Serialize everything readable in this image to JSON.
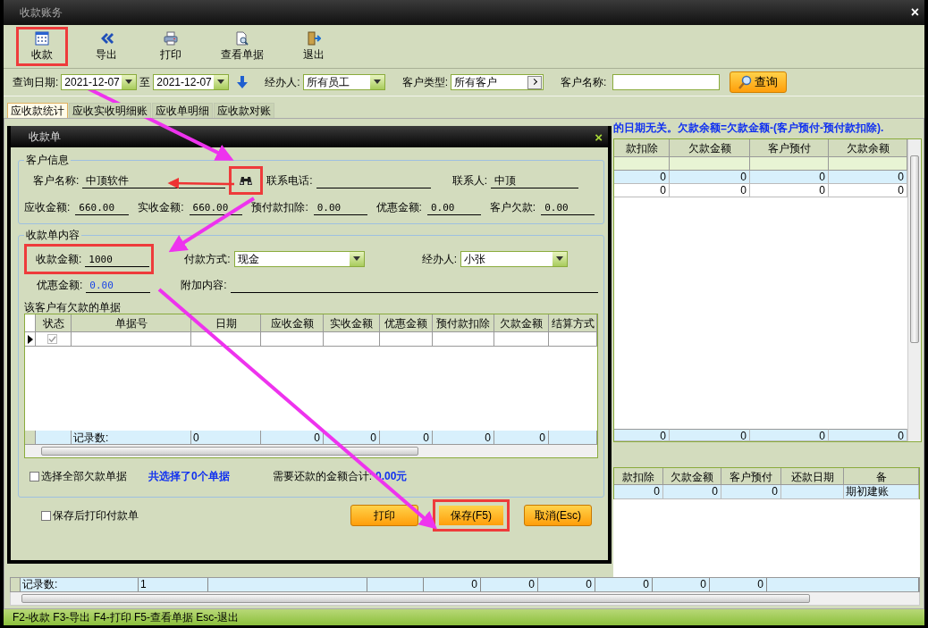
{
  "window": {
    "title": "收款账务",
    "close": "×"
  },
  "toolbar": [
    {
      "label": "收款",
      "kind": "calendar",
      "highlighted": true
    },
    {
      "label": "导出",
      "kind": "chevrons",
      "highlighted": false
    },
    {
      "label": "打印",
      "kind": "printer",
      "highlighted": false
    },
    {
      "label": "查看单据",
      "kind": "document",
      "highlighted": false
    },
    {
      "label": "退出",
      "kind": "exit",
      "highlighted": false
    }
  ],
  "filters": {
    "date_label": "查询日期:",
    "date_from": "2021-12-07",
    "to_label": "至",
    "date_to": "2021-12-07",
    "handler_label": "经办人:",
    "handler": "所有员工",
    "type_label": "客户类型:",
    "type": "所有客户",
    "name_label": "客户名称:",
    "query_button": "查询"
  },
  "tabs": [
    {
      "label": "应收款统计",
      "selected": true
    },
    {
      "label": "应收实收明细账",
      "selected": false
    },
    {
      "label": "应收单明细",
      "selected": false
    },
    {
      "label": "应收款对账",
      "selected": false
    }
  ],
  "notice": "的日期无关。欠款余额=欠款金额-(客户预付-预付款扣除).",
  "upper_grid": {
    "columns": [
      "款扣除",
      "欠款金额",
      "客户预付",
      "欠款余额"
    ],
    "rows": [
      {
        "cells": [
          "0",
          "0",
          "0",
          "0"
        ],
        "selected": true
      },
      {
        "cells": [
          "0",
          "0",
          "0",
          "0"
        ],
        "selected": false
      }
    ],
    "totals": [
      "0",
      "0",
      "0",
      "0"
    ]
  },
  "lower_grid": {
    "columns": [
      "款扣除",
      "欠款金额",
      "客户预付",
      "还款日期",
      "备"
    ],
    "rows": [
      {
        "deduction": "0",
        "arrears": "0",
        "prepaid": "0",
        "note": "期初建账",
        "selected": true
      }
    ]
  },
  "footer": {
    "label": "记录数:",
    "count": "1",
    "values": [
      "0",
      "0",
      "0",
      "0",
      "0",
      "0"
    ]
  },
  "status_bar": "F2-收款 F3-导出 F4-打印 F5-查看单据 Esc-退出",
  "dialog": {
    "title": "收款单",
    "close": "×",
    "customer_group": "客户信息",
    "customer_name_label": "客户名称:",
    "customer_name": "中顶软件",
    "lookup_highlighted": true,
    "phone_label": "联系电话:",
    "contact_label": "联系人:",
    "contact": "中顶",
    "amounts": [
      {
        "label": "应收金额:",
        "value": "660.00"
      },
      {
        "label": "实收金额:",
        "value": "660.00"
      },
      {
        "label": "预付款扣除:",
        "value": "0.00"
      },
      {
        "label": "优惠金额:",
        "value": "0.00"
      },
      {
        "label": "客户欠款:",
        "value": "0.00"
      }
    ],
    "receipt_group": "收款单内容",
    "receipt_amount_label": "收款金额:",
    "receipt_amount": "1000",
    "receipt_highlighted": true,
    "pay_method_label": "付款方式:",
    "pay_method": "现金",
    "handler_label": "经办人:",
    "handler": "小张",
    "discount_label": "优惠金额:",
    "discount": "0.00",
    "extra_label": "附加内容:",
    "debts_group": "该客户有欠款的单据",
    "debt_columns": [
      "状态",
      "单据号",
      "日期",
      "应收金额",
      "实收金额",
      "优惠金额",
      "预付款扣除",
      "欠款金额",
      "结算方式"
    ],
    "debt_rows": [
      {
        "checked": true
      }
    ],
    "debt_totals_label": "记录数:",
    "debt_totals": [
      "0",
      "0",
      "0",
      "0",
      "0",
      "0"
    ],
    "select_all": {
      "label": "选择全部欠款单据",
      "checked": false
    },
    "selected_count": "共选择了0个单据",
    "sum_label": "需要还款的金额合计:",
    "sum": "0.00元",
    "print_after_save": {
      "label": "保存后打印付款单",
      "checked": false
    },
    "buttons": [
      {
        "label": "打印",
        "highlighted": false
      },
      {
        "label": "保存(F5)",
        "highlighted": true
      },
      {
        "label": "取消(Esc)",
        "highlighted": false
      }
    ]
  }
}
